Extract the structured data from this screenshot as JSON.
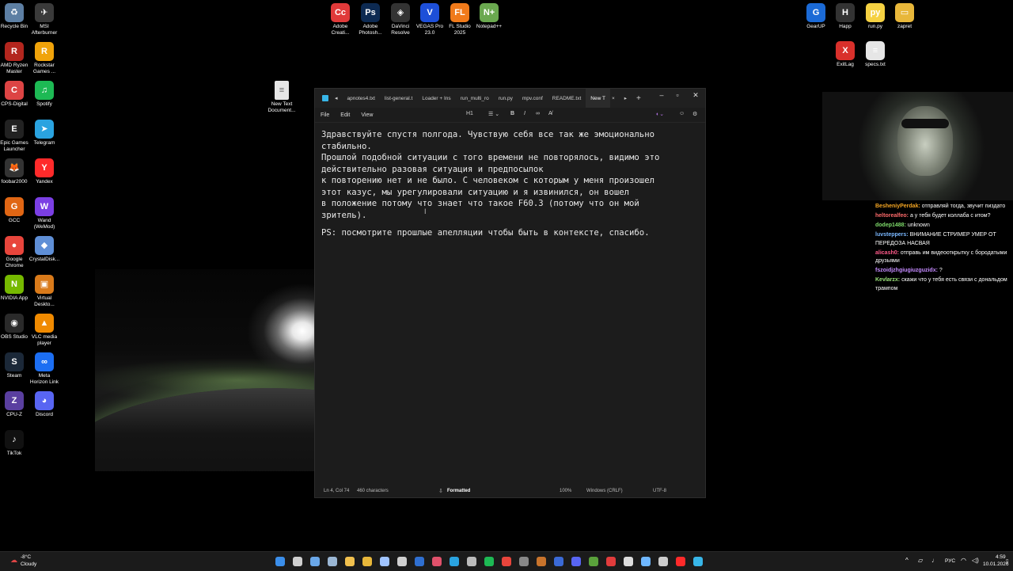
{
  "desktop_left": [
    {
      "label": "Recycle Bin",
      "color": "#5d7fa3",
      "glyph": "♻",
      "icon": "recycle-bin-icon"
    },
    {
      "label": "MSI\nAfterburner",
      "color": "#3a3a3a",
      "glyph": "✈",
      "icon": "msi-afterburner-icon"
    },
    {
      "label": "AMD Ryzen\nMaster",
      "color": "#b3261e",
      "glyph": "R",
      "icon": "amd-ryzen-icon"
    },
    {
      "label": "Rockstar\nGames ...",
      "color": "#f0a30a",
      "glyph": "R",
      "icon": "rockstar-icon"
    },
    {
      "label": "CPS-Digital",
      "color": "#d44",
      "glyph": "C",
      "icon": "cps-digital-icon"
    },
    {
      "label": "Spotify",
      "color": "#1db954",
      "glyph": "♫",
      "icon": "spotify-icon"
    },
    {
      "label": "Epic Games\nLauncher",
      "color": "#222",
      "glyph": "E",
      "icon": "epic-games-icon"
    },
    {
      "label": "Telegram",
      "color": "#2aa3e0",
      "glyph": "➤",
      "icon": "telegram-icon"
    },
    {
      "label": "foobar2000",
      "color": "#333",
      "glyph": "🦊",
      "icon": "foobar-icon"
    },
    {
      "label": "Yandex",
      "color": "#ff2a2a",
      "glyph": "Y",
      "icon": "yandex-icon"
    },
    {
      "label": "GCC",
      "color": "#e06614",
      "glyph": "G",
      "icon": "gcc-icon"
    },
    {
      "label": "Wand\n(WeMod)",
      "color": "#7b3fe4",
      "glyph": "W",
      "icon": "wand-icon"
    },
    {
      "label": "Google\nChrome",
      "color": "#e8453c",
      "glyph": "●",
      "icon": "chrome-icon"
    },
    {
      "label": "CrystalDisk...",
      "color": "#5f8fd6",
      "glyph": "◆",
      "icon": "crystaldisk-icon"
    },
    {
      "label": "NVIDIA App",
      "color": "#76b900",
      "glyph": "N",
      "icon": "nvidia-icon"
    },
    {
      "label": "Virtual\nDeskto...",
      "color": "#d97a1a",
      "glyph": "▣",
      "icon": "virtual-desktop-icon"
    },
    {
      "label": "OBS Studio",
      "color": "#2a2a2a",
      "glyph": "◉",
      "icon": "obs-icon"
    },
    {
      "label": "VLC media\nplayer",
      "color": "#f08a00",
      "glyph": "▲",
      "icon": "vlc-icon"
    },
    {
      "label": "Steam",
      "color": "#1b2838",
      "glyph": "S",
      "icon": "steam-icon"
    },
    {
      "label": "Meta\nHorizon Link",
      "color": "#1c6ef2",
      "glyph": "∞",
      "icon": "meta-icon"
    },
    {
      "label": "CPU-Z",
      "color": "#5a3fa0",
      "glyph": "Z",
      "icon": "cpuz-icon"
    },
    {
      "label": "Discord",
      "color": "#5865f2",
      "glyph": "◕",
      "icon": "discord-icon"
    },
    {
      "label": "TikTok",
      "color": "#111",
      "glyph": "♪",
      "icon": "tiktok-icon"
    }
  ],
  "desktop_top": [
    {
      "label": "Adobe\nCreati...",
      "color": "#e03a3a",
      "glyph": "Cc",
      "icon": "adobe-cc-icon"
    },
    {
      "label": "Adobe\nPhotosh...",
      "color": "#0d2a52",
      "glyph": "Ps",
      "icon": "photoshop-icon"
    },
    {
      "label": "DaVinci\nResolve",
      "color": "#333",
      "glyph": "◈",
      "icon": "davinci-icon"
    },
    {
      "label": "VEGAS Pro\n23.0",
      "color": "#1d4fd8",
      "glyph": "V",
      "icon": "vegas-icon"
    },
    {
      "label": "FL Studio\n2025",
      "color": "#f07a1a",
      "glyph": "FL",
      "icon": "fl-studio-icon"
    },
    {
      "label": "Notepad++",
      "color": "#6aa84f",
      "glyph": "N+",
      "icon": "notepadpp-icon"
    }
  ],
  "desktop_right": [
    {
      "label": "GearUP",
      "color": "#1b6ad6",
      "glyph": "G",
      "icon": "gearup-icon"
    },
    {
      "label": "Happ",
      "color": "#333",
      "glyph": "H",
      "icon": "happ-icon"
    },
    {
      "label": "run.py",
      "color": "#f5d142",
      "glyph": "py",
      "icon": "python-file-icon"
    },
    {
      "label": "zapret",
      "color": "#e8b73a",
      "glyph": "▭",
      "icon": "folder-icon"
    },
    {
      "label": "ExitLag",
      "color": "#d9302b",
      "glyph": "X",
      "icon": "exitlag-icon"
    },
    {
      "label": "specs.txt",
      "color": "#e6e6e6",
      "glyph": "≡",
      "icon": "text-file-icon"
    }
  ],
  "desktop_file": {
    "label": "New Text\nDocument...",
    "icon": "text-file-icon"
  },
  "notepad": {
    "tabs": [
      "apnotes4.txt",
      "list-general.t",
      "Loader + Ins",
      "run_multi_ro",
      "run.py",
      "mpv.conf",
      "README.txt",
      "New T"
    ],
    "menus": [
      "File",
      "Edit",
      "View"
    ],
    "heading_label": "H1",
    "content_lines": [
      "Здравствуйте спустя полгода. Чувствую себя все так же эмоционально",
      "стабильно.",
      "Прошлой подобной ситуации с того времени не повторялось, видимо это",
      "действительно разовая ситуация и предпосылок",
      "к повторению нет и не было. С человеком с которым у меня произошел",
      "этот казус, мы урегулировали ситуацию и я извинился, он вошел",
      "в положение потому что знает что такое F60.3 (потому что он мой",
      "зритель).",
      "",
      "PS: посмотрите прошлые апелляции чтобы быть в контексте, спасибо."
    ],
    "status": {
      "position": "Ln 4, Col 74",
      "characters": "460 characters",
      "mode": "Formatted",
      "zoom": "100%",
      "line_endings": "Windows (CRLF)",
      "encoding": "UTF-8"
    }
  },
  "chat": [
    {
      "nick": "BesheniyPerdak:",
      "color": "#f5a623",
      "text": "отправляй тогда, звучит пиздато"
    },
    {
      "nick": "heltorealfeo:",
      "color": "#ff6b6b",
      "text": "а у тебя будет коллаба с итом?"
    },
    {
      "nick": "dodep1488:",
      "color": "#7fdc6b",
      "text": "unknown"
    },
    {
      "nick": "luvsteppers:",
      "color": "#7ab8ff",
      "text": "ВНИМАНИЕ СТРИМЕР УМЕР ОТ ПЕРЕДОЗА НАСВАЯ"
    },
    {
      "nick": "alicash0:",
      "color": "#ff5a8a",
      "text": "отправь им видеооткрытку с бородатыми друзьями"
    },
    {
      "nick": "fszoidjzhgiugiuzguzidx:",
      "color": "#c58bff",
      "text": "?"
    },
    {
      "nick": "Kevlarzx:",
      "color": "#9be37a",
      "text": "скажи что у тебя есть связи с дональдом трампом"
    }
  ],
  "taskbar": {
    "weather_temp": "-8°C",
    "weather_desc": "Cloudy",
    "lang": "РУС",
    "time": "4:59",
    "date": "10.01.2026",
    "apps": [
      {
        "icon": "start-icon",
        "color": "#3b8eea"
      },
      {
        "icon": "search-icon",
        "color": "#cfcfcf"
      },
      {
        "icon": "widgets-icon",
        "color": "#6aa7e8"
      },
      {
        "icon": "help-icon",
        "color": "#9bb7d4"
      },
      {
        "icon": "explorer-icon",
        "color": "#f2c14e"
      },
      {
        "icon": "folder-icon",
        "color": "#e8b73a"
      },
      {
        "icon": "keyboard-icon",
        "color": "#a0c4ff"
      },
      {
        "icon": "clipboard-icon",
        "color": "#d0d0d0"
      },
      {
        "icon": "photoshop-icon",
        "color": "#2f6fd1"
      },
      {
        "icon": "notepad-icon",
        "color": "#e0516b"
      },
      {
        "icon": "telegram-icon",
        "color": "#2aa3e0"
      },
      {
        "icon": "gear-icon",
        "color": "#bbbbbb"
      },
      {
        "icon": "spotify-icon",
        "color": "#1db954"
      },
      {
        "icon": "chrome-icon",
        "color": "#e8453c"
      },
      {
        "icon": "obs-icon",
        "color": "#888888"
      },
      {
        "icon": "davinci-icon",
        "color": "#c9742c"
      },
      {
        "icon": "gearup-icon",
        "color": "#3b6ad6"
      },
      {
        "icon": "discord-icon",
        "color": "#5865f2"
      },
      {
        "icon": "minecraft-icon",
        "color": "#5aa13b"
      },
      {
        "icon": "app-icon",
        "color": "#e23c3c"
      },
      {
        "icon": "happ-icon",
        "color": "#dddddd"
      },
      {
        "icon": "taskmgr-icon",
        "color": "#6fb7ff"
      },
      {
        "icon": "media-icon",
        "color": "#cccccc"
      },
      {
        "icon": "yandex-icon",
        "color": "#ff2a2a"
      },
      {
        "icon": "notepad-icon",
        "color": "#38b6e8"
      }
    ]
  }
}
